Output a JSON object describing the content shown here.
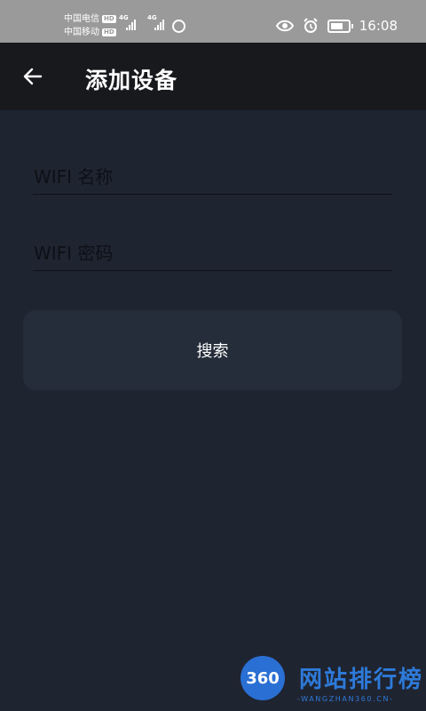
{
  "status_bar": {
    "carrier_1": "中国电信",
    "carrier_2": "中国移动",
    "hd_badge": "HD",
    "network_1": "4G",
    "network_2": "4G",
    "time": "16:08"
  },
  "app_bar": {
    "title": "添加设备",
    "back_icon": "arrow-left-icon"
  },
  "form": {
    "wifi_name": {
      "placeholder": "WIFI 名称",
      "value": ""
    },
    "wifi_password": {
      "placeholder": "WIFI 密码",
      "value": ""
    },
    "search_label": "搜索"
  },
  "watermark": {
    "badge": "360",
    "title": "网站排行榜",
    "subtitle": "-WANGZHAN360.CN-"
  },
  "colors": {
    "background": "#1f2431",
    "app_bar": "#18191d",
    "button": "#252d3a",
    "status_bar": "#9a9a9a",
    "watermark": "#2d7ad9"
  }
}
